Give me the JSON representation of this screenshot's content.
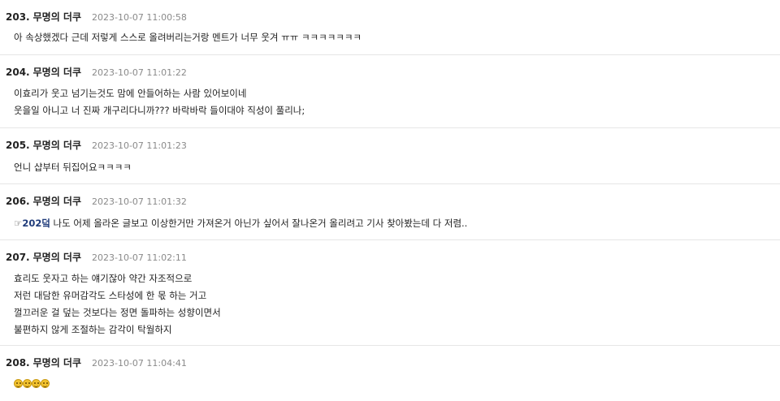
{
  "comments": [
    {
      "number": "203.",
      "author": "무명의 더쿠",
      "time": "2023-10-07 11:00:58",
      "lines": [
        "아 속상했겠다 근데 저렇게 스스로 올려버리는거랑 멘트가 너무 웃겨 ㅠㅠ ㅋㅋㅋㅋㅋㅋㅋ"
      ]
    },
    {
      "number": "204.",
      "author": "무명의 더쿠",
      "time": "2023-10-07 11:01:22",
      "lines": [
        "이효리가 웃고 넘기는것도 맘에 안들어하는 사람 있어보이네",
        "웃을일 아니고 너 진짜 개구리다니까??? 바락바락 들이대야 직성이 풀리나;"
      ]
    },
    {
      "number": "205.",
      "author": "무명의 더쿠",
      "time": "2023-10-07 11:01:23",
      "lines": [
        "언니 샵부터 뒤집어요ㅋㅋㅋㅋ"
      ]
    },
    {
      "number": "206.",
      "author": "무명의 더쿠",
      "time": "2023-10-07 11:01:32",
      "ref_prefix": "☞",
      "ref": "202덬",
      "ref_text": " 나도 어제 올라온 글보고 이상한거만 가져온거 아닌가 싶어서 잘나온거 올리려고 기사 찾아봤는데 다 저렴.."
    },
    {
      "number": "207.",
      "author": "무명의 더쿠",
      "time": "2023-10-07 11:02:11",
      "lines": [
        "효리도 웃자고 하는 얘기잖아 약간 자조적으로",
        "저런 대담한 유머감각도 스타성에 한 몫 하는 거고",
        "껄끄러운 걸 덮는 것보다는 정면 돌파하는 성향이면서",
        "불편하지 않게 조절하는 감각이 탁월하지"
      ]
    },
    {
      "number": "208.",
      "author": "무명의 더쿠",
      "time": "2023-10-07 11:04:41",
      "emoji_icons": [
        "grinning-face-icon",
        "grinning-face-icon",
        "grinning-face-icon",
        "grinning-face-icon"
      ]
    }
  ]
}
